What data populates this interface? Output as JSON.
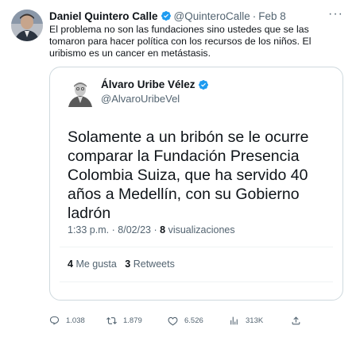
{
  "tweet": {
    "author_name": "Daniel Quintero Calle",
    "author_handle": "@QuinteroCalle",
    "separator": "·",
    "date": "Feb 8",
    "more_label": "···",
    "text": "El problema no son las fundaciones sino ustedes que se las tomaron para hacer política con los recursos de los niños. El uribismo es un cancer en metástasis."
  },
  "quoted": {
    "author_name": "Álvaro Uribe Vélez",
    "author_handle": "@AlvaroUribeVel",
    "text": "Solamente a un bribón se le ocurre comparar la Fundación Presencia Colombia Suiza, que ha servido 40 años a Medellín, con su Gobierno ladrón",
    "time": "1:33 p.m.",
    "separator": "·",
    "date": "8/02/23",
    "views_count": "8",
    "views_label": "visualizaciones",
    "likes_count": "4",
    "likes_label": "Me gusta",
    "retweets_count": "3",
    "retweets_label": "Retweets"
  },
  "actions": {
    "reply_count": "1.038",
    "retweet_count": "1.879",
    "like_count": "6.526",
    "views_count": "313K"
  },
  "icons": {
    "verified": "verified-badge-icon",
    "reply": "reply-icon",
    "retweet": "retweet-icon",
    "like": "heart-icon",
    "views": "views-chart-icon",
    "share": "share-icon",
    "more": "more-options-icon"
  },
  "colors": {
    "verified": "#1d9bf0",
    "text": "#0f1419",
    "secondary": "#536471",
    "border": "#cfd9de"
  }
}
